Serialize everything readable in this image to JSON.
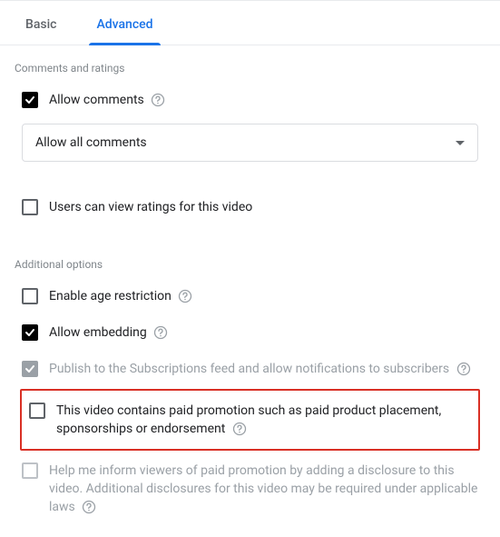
{
  "tabs": {
    "basic": "Basic",
    "advanced": "Advanced"
  },
  "section1": {
    "heading": "Comments and ratings"
  },
  "allowComments": {
    "label": "Allow comments"
  },
  "commentsSelect": {
    "value": "Allow all comments"
  },
  "ratings": {
    "label": "Users can view ratings for this video"
  },
  "section2": {
    "heading": "Additional options"
  },
  "ageRestriction": {
    "label": "Enable age restriction"
  },
  "embedding": {
    "label": "Allow embedding"
  },
  "subscriptions": {
    "label": "Publish to the Subscriptions feed and allow notifications to subscribers"
  },
  "paidPromotion": {
    "label": "This video contains paid promotion such as paid product placement, sponsorships or endorsement"
  },
  "informViewers": {
    "label": "Help me inform viewers of paid promotion by adding a disclosure to this video. Additional disclosures for this video may be required under applicable laws"
  }
}
